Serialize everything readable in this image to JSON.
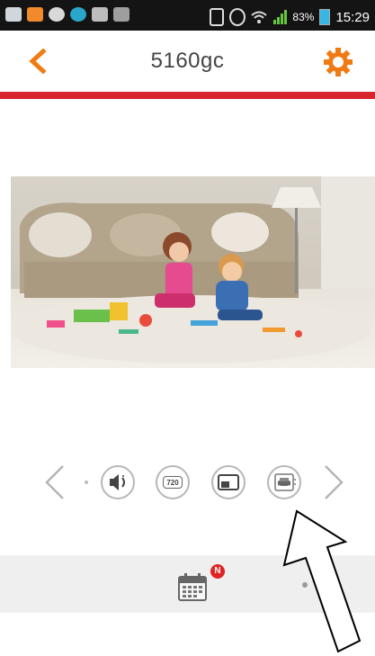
{
  "status_bar": {
    "battery_percent": "83%",
    "time": "15:29",
    "icons": [
      "gallery-icon",
      "app-icon",
      "chat-icon",
      "app-icon",
      "upload-icon",
      "photo-icon",
      "vibrate-icon",
      "sync-icon",
      "wifi-icon",
      "signal-icon",
      "battery-icon"
    ]
  },
  "app_bar": {
    "title": "5160gc",
    "back_icon": "chevron-left-icon",
    "settings_icon": "gear-icon",
    "accent_color": "#f07b14",
    "rule_color": "#d7242d"
  },
  "video": {
    "description_icon": "live-camera-feed"
  },
  "controls": {
    "buttons": [
      "speaker-icon",
      "resolution-720-icon",
      "picture-in-picture-icon",
      "car-parking-icon"
    ],
    "resolution_label": "720"
  },
  "tab_bar": {
    "calendar_icon": "calendar-icon",
    "badge_text": "N",
    "badge_color": "#e02424"
  }
}
